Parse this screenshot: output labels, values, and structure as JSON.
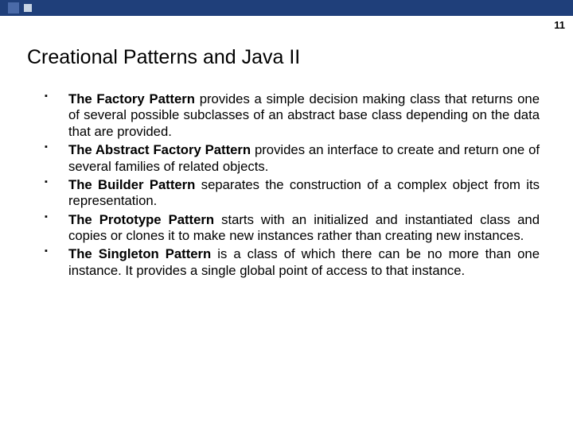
{
  "page_number": "11",
  "title": "Creational Patterns and Java II",
  "bullets": [
    {
      "bold": "The Factory Pattern",
      "rest": " provides a simple decision making class that returns one of several possible subclasses of an abstract base class depending on the data that are provided."
    },
    {
      "bold": "The Abstract Factory Pattern",
      "rest": " provides an interface to create and return one of several families of related objects."
    },
    {
      "bold": "The Builder Pattern",
      "rest": " separates the construction of a complex object from its representation."
    },
    {
      "bold": "The Prototype Pattern",
      "rest": " starts with an initialized and instantiated class and copies or clones it to make new instances rather than creating new instances."
    },
    {
      "bold": "The Singleton Pattern",
      "rest": " is a class of which there can be no more than one instance. It provides a single global point of access to that instance."
    }
  ]
}
